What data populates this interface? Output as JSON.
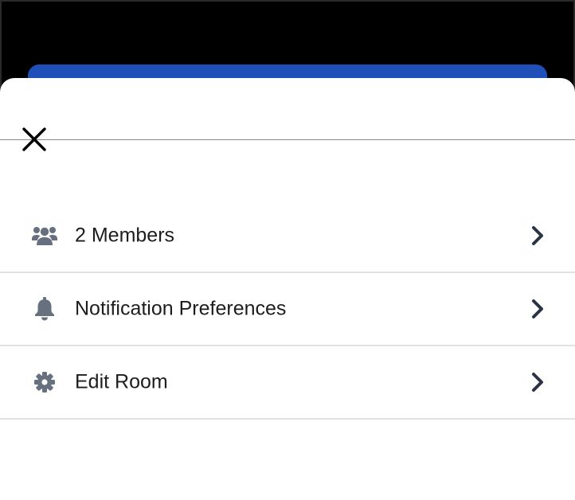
{
  "colors": {
    "backdrop": "#000000",
    "accent_button": "#1f4fb8",
    "sheet_background": "#ffffff",
    "icon_gray": "#66707e",
    "chevron_dark": "#2b3445",
    "label_text": "#1d1d1f",
    "divider": "#e2e2e2"
  },
  "sheet": {
    "close_icon": "close-icon"
  },
  "menu": {
    "items": [
      {
        "label": "2 Members",
        "icon": "members-icon",
        "chevron": "chevron-right-icon"
      },
      {
        "label": "Notification Preferences",
        "icon": "bell-icon",
        "chevron": "chevron-right-icon"
      },
      {
        "label": "Edit Room",
        "icon": "gear-icon",
        "chevron": "chevron-right-icon"
      }
    ]
  }
}
